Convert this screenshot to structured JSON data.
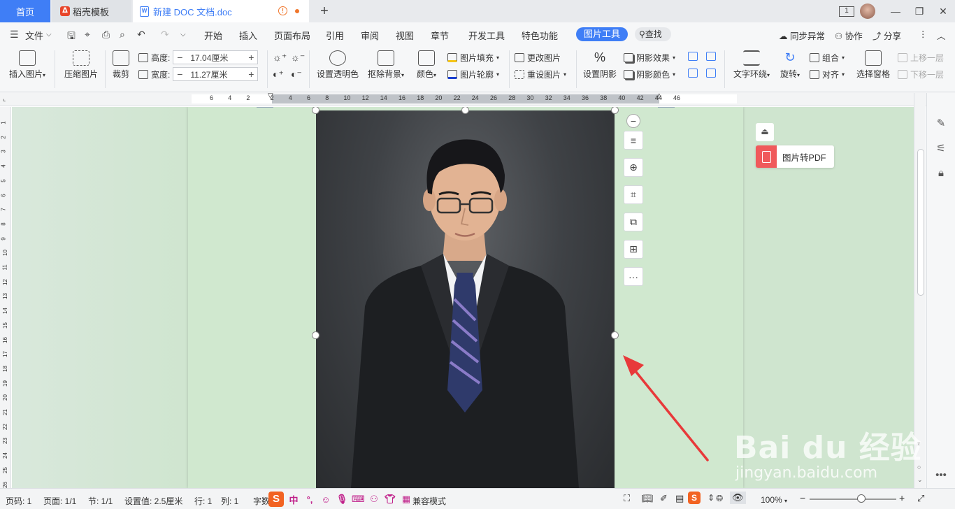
{
  "tabs": {
    "home": "首页",
    "template": "稻壳模板",
    "doc": "新建 DOC 文档.doc",
    "warn_glyph": "!",
    "add_glyph": "+",
    "doc_icon_letter": "W"
  },
  "window": {
    "badge": "1",
    "minimize": "—",
    "restore": "❐",
    "close": "✕"
  },
  "menu": {
    "file": "文件",
    "items": [
      "开始",
      "插入",
      "页面布局",
      "引用",
      "审阅",
      "视图",
      "章节",
      "开发工具",
      "特色功能"
    ],
    "active_tool": "图片工具",
    "search": "查找",
    "sync": "同步异常",
    "collab": "协作",
    "share": "分享",
    "more": "⋮",
    "collapse": "︿"
  },
  "ribbon": {
    "insert_picture": "插入图片",
    "compress_picture": "压缩图片",
    "crop": "裁剪",
    "height_label": "高度:",
    "height_value": "17.04厘米",
    "width_label": "宽度:",
    "width_value": "11.27厘米",
    "set_transparent": "设置透明色",
    "remove_bg": "抠除背景",
    "color": "颜色",
    "pic_fill": "图片填充",
    "pic_outline": "图片轮廓",
    "change_pic": "更改图片",
    "reset_pic": "重设图片",
    "set_shadow": "设置阴影",
    "shadow_effect": "阴影效果",
    "shadow_color": "阴影颜色",
    "text_wrap": "文字环绕",
    "rotate": "旋转",
    "group": "组合",
    "align": "对齐",
    "selection_pane": "选择窗格",
    "bring_forward": "上移一层",
    "send_backward": "下移一层"
  },
  "ruler": {
    "h_ticks": [
      "6",
      "4",
      "2",
      "2",
      "4",
      "6",
      "8",
      "10",
      "12",
      "14",
      "16",
      "18",
      "20",
      "22",
      "24",
      "26",
      "28",
      "30",
      "32",
      "34",
      "36",
      "38",
      "40",
      "42",
      "44",
      "46"
    ],
    "v_ticks": [
      "1",
      "2",
      "3",
      "4",
      "5",
      "6",
      "7",
      "8",
      "9",
      "10",
      "11",
      "12",
      "13",
      "14",
      "15",
      "16",
      "17",
      "18",
      "19",
      "20",
      "21",
      "22",
      "23",
      "24",
      "25",
      "26"
    ]
  },
  "float_tools": [
    "−",
    "≡",
    "⊕",
    "⌗",
    "⧉",
    "⊞",
    "···"
  ],
  "pdf_panel": {
    "collapse": "⏏",
    "label": "图片转PDF"
  },
  "status": {
    "page_num": "页码: 1",
    "pages": "页面: 1/1",
    "section": "节: 1/1",
    "setting": "设置值: 2.5厘米",
    "row": "行: 1",
    "col": "列: 1",
    "chars": "字数",
    "compat": "兼容模式",
    "zoom": "100%",
    "zoom_minus": "−",
    "zoom_plus": "+"
  },
  "ime": {
    "logo": "S",
    "cn": "中",
    "punct": "°,"
  },
  "watermark": {
    "brand": "Bai du 经验",
    "url": "jingyan.baidu.com"
  },
  "colors": {
    "accent": "#3f7ef6",
    "page_bg": "#d0e8cf",
    "arrow": "#e8393a"
  }
}
